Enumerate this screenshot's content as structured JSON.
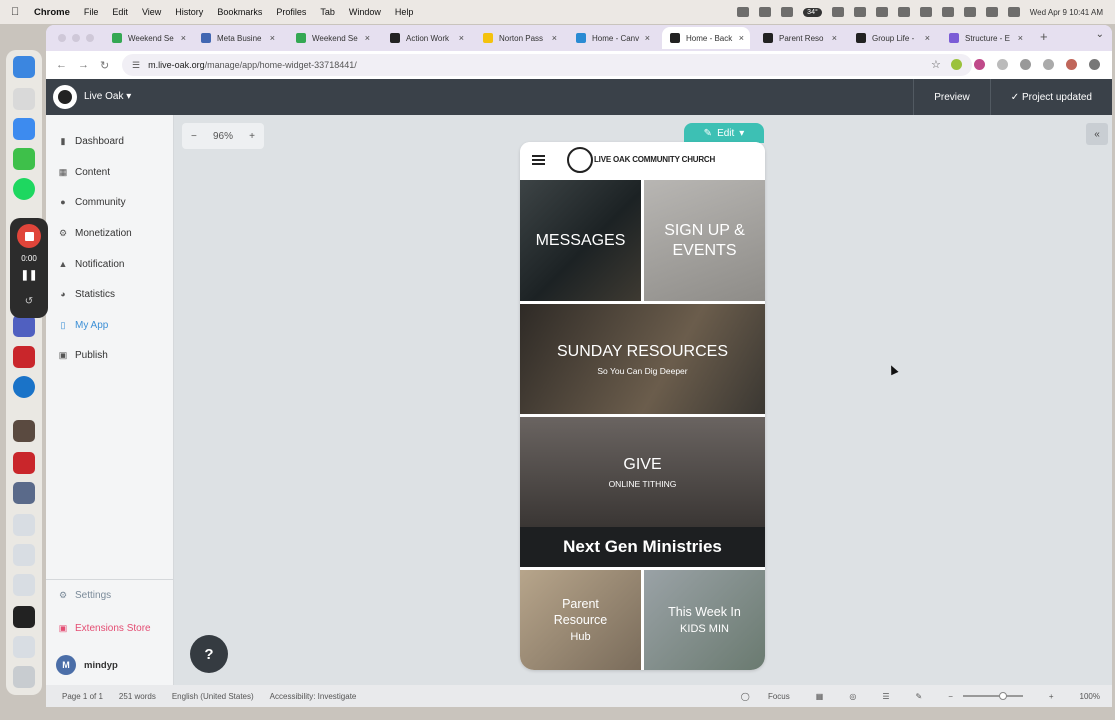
{
  "menubar": {
    "app": "Chrome",
    "items": [
      "File",
      "Edit",
      "View",
      "History",
      "Bookmarks",
      "Profiles",
      "Tab",
      "Window",
      "Help"
    ],
    "temperature": "34°",
    "datetime": "Wed Apr 9  10:41 AM"
  },
  "recorder": {
    "time": "0:00"
  },
  "browser": {
    "tabs": [
      {
        "label": "Weekend Se",
        "color": "#34a853"
      },
      {
        "label": "Meta Busine",
        "color": "#4267b2"
      },
      {
        "label": "Weekend Se",
        "color": "#34a853"
      },
      {
        "label": "Action Work",
        "color": "#222222"
      },
      {
        "label": "Norton Pass",
        "color": "#f4c20d"
      },
      {
        "label": "Home - Canv",
        "color": "#2a8bd3"
      },
      {
        "label": "Home - Back",
        "color": "#222222"
      },
      {
        "label": "Parent Reso",
        "color": "#222222"
      },
      {
        "label": "Group Life -",
        "color": "#222222"
      },
      {
        "label": "Structure - E",
        "color": "#7b5cd6"
      }
    ],
    "url_host": "m.live-oak.org",
    "url_path": "/manage/app/home-widget-33718441/"
  },
  "app": {
    "name": "Live Oak",
    "preview_label": "Preview",
    "project_status": "Project updated",
    "zoom": "96%",
    "edit_label": "Edit",
    "sidebar": {
      "items": [
        {
          "label": "Dashboard",
          "icon": "bar-chart-icon"
        },
        {
          "label": "Content",
          "icon": "document-icon"
        },
        {
          "label": "Community",
          "icon": "person-icon"
        },
        {
          "label": "Monetization",
          "icon": "gear-icon"
        },
        {
          "label": "Notification",
          "icon": "bell-icon"
        },
        {
          "label": "Statistics",
          "icon": "pie-chart-icon"
        },
        {
          "label": "My App",
          "icon": "phone-icon"
        },
        {
          "label": "Publish",
          "icon": "store-icon"
        }
      ],
      "settings": "Settings",
      "extensions": "Extensions Store",
      "user": "mindyp",
      "user_initials": "M"
    },
    "help_label": "?"
  },
  "phone": {
    "church": "LIVE OAK COMMUNITY CHURCH",
    "tiles": {
      "messages": "MESSAGES",
      "signup": "SIGN UP & EVENTS",
      "sunday_title": "SUNDAY RESOURCES",
      "sunday_sub": "So You Can Dig Deeper",
      "give_title": "GIVE",
      "give_sub": "ONLINE TITHING",
      "nextgen": "Next Gen Ministries",
      "parent_title": "Parent Resource",
      "parent_sub": "Hub",
      "week_title": "This Week In",
      "week_sub": "KIDS MIN"
    }
  },
  "statusbar": {
    "page": "Page 1 of 1",
    "words": "251 words",
    "language": "English (United States)",
    "accessibility": "Accessibility: Investigate",
    "focus": "Focus",
    "zoom": "100%"
  }
}
